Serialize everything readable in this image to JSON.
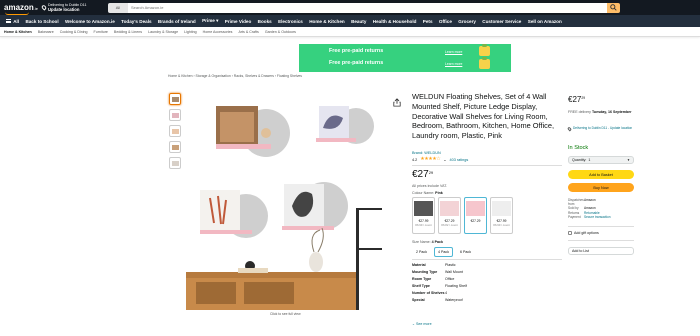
{
  "header": {
    "logo_text": "amazon",
    "logo_tld": ".ie",
    "deliver_line1": "Delivering to Dublin D11",
    "deliver_line2": "Update location",
    "search_category": "All",
    "search_placeholder": "Search Amazon.ie"
  },
  "nav": {
    "all_label": "All",
    "items": [
      "Back to School",
      "Welcome to Amazon.ie",
      "Today's Deals",
      "Brands of Ireland",
      "Prime ▾",
      "Prime Video",
      "Books",
      "Electronics",
      "Home & Kitchen",
      "Beauty",
      "Health & Household",
      "Pets",
      "Office",
      "Grocery",
      "Customer Service",
      "Sell on Amazon"
    ]
  },
  "subnav": {
    "items": [
      "Home & Kitchen",
      "Bakeware",
      "Cooking & Dining",
      "Furniture",
      "Bedding & Linens",
      "Laundry & Storage",
      "Lighting",
      "Home Accessories",
      "Arts & Crafts",
      "Garden & Outdoors"
    ]
  },
  "banner": {
    "line1": "Free pre-paid returns",
    "line2": "Free pre-paid returns",
    "learn1": "Learn more",
    "learn2": "Learn more"
  },
  "breadcrumb": "Home & Kitchen  ›  Storage & Organisation  ›  Racks, Shelves & Drawers  ›  Floating Shelves",
  "image_caption": "Click to see full view",
  "product": {
    "title": "WELDUN Floating Shelves, Set of 4 Wall Mounted Shelf, Picture Ledge Display, Decorative Wall Shelves for Living Room, Bedroom, Bathroom, Kitchen, Home Office, Laundry room, Plastic, Pink",
    "brand_link": "Brand: WELDUN",
    "rating_value": "4.2",
    "stars": "★★★★☆",
    "ratings_count": "403 ratings",
    "price_whole": "€27",
    "price_fraction": "29",
    "all_prices_note": "All prices include VAT.",
    "colour_label": "Colour Name:",
    "colour_value": "Pink",
    "swatches": [
      {
        "price": "€27.99",
        "sub": "€6.99 / count",
        "color": "#555555"
      },
      {
        "price": "€27.29",
        "sub": "€6.82 / count",
        "color": "#f3d3d6"
      },
      {
        "price": "€27.29",
        "sub": "",
        "color": "#f6c6cd"
      },
      {
        "price": "€27.99",
        "sub": "€6.99 / count",
        "color": "#eeeeee"
      }
    ],
    "size_label": "Size Name:",
    "size_value": "4 Pack",
    "sizes": [
      "2 Pack",
      "4 Pack",
      "6 Pack"
    ],
    "specs": [
      {
        "k": "Material",
        "v": "Plastic"
      },
      {
        "k": "Mounting Type",
        "v": "Wall Mount"
      },
      {
        "k": "Room Type",
        "v": "Office"
      },
      {
        "k": "Shelf Type",
        "v": "Floating Shelf"
      },
      {
        "k": "Number of Shelves",
        "v": "4"
      },
      {
        "k": "Special",
        "v": "Waterproof"
      }
    ],
    "see_more": "⌄ See more"
  },
  "buybox": {
    "price_whole": "€27",
    "price_fraction": "29",
    "delivery_prefix": "FREE delivery",
    "delivery_date": "Tuesday, 16 September",
    "location": "Delivering to Dublin D11 - Update location",
    "stock": "In Stock",
    "quantity_label": "Quantity:",
    "quantity_value": "1",
    "add_to_basket": "Add to Basket",
    "buy_now": "Buy Now",
    "details": [
      {
        "k": "Dispatches from",
        "v": "Amazon",
        "link": false
      },
      {
        "k": "Sold by",
        "v": "Amazon",
        "link": false
      },
      {
        "k": "Returns",
        "v": "Returnable",
        "link": true
      },
      {
        "k": "Payment",
        "v": "Secure transaction",
        "link": true
      }
    ],
    "gift_options": "Add gift options",
    "add_to_list": "Add to List"
  },
  "colors": {
    "header_bg": "#131921",
    "nav_bg": "#232f3e",
    "banner_green": "#36d17f",
    "link": "#007185",
    "in_stock": "#007600",
    "cart_yellow": "#ffd814",
    "buy_orange": "#ffa41c"
  }
}
